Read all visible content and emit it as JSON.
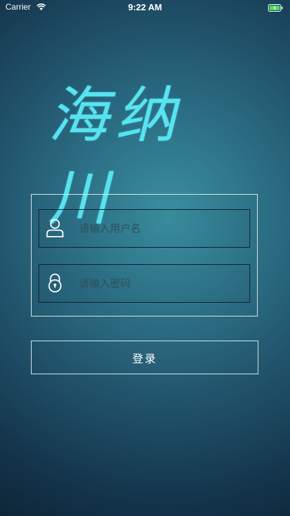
{
  "status_bar": {
    "carrier": "Carrier",
    "time": "9:22 AM",
    "icons": [
      "wifi-icon",
      "battery-icon"
    ]
  },
  "logo": {
    "text": "海纳川",
    "color": "#58e3f0"
  },
  "form": {
    "username": {
      "placeholder": "请输入用户名",
      "value": "",
      "icon": "user-icon"
    },
    "password": {
      "placeholder": "请输入密码",
      "value": "",
      "icon": "lock-icon"
    }
  },
  "login_button": {
    "label": "登录"
  },
  "colors": {
    "background_center": "#3a8fa0",
    "background_edge": "#0d2233",
    "border_light": "#d7e6ea",
    "border_dark": "#10212c",
    "placeholder": "#2d4f5d"
  }
}
